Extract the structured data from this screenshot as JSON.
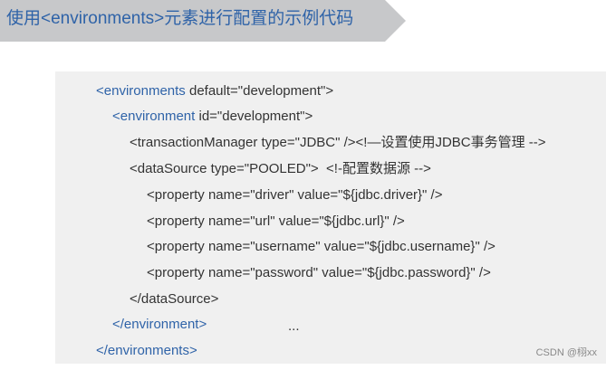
{
  "header": {
    "title": "使用<environments>元素进行配置的示例代码"
  },
  "code": {
    "line1_tag": "<environments",
    "line1_rest": " default=\"development\">",
    "line2_tag": "<environment",
    "line2_rest": " id=\"development\">",
    "line3": "<transactionManager type=\"JDBC\" /><!—设置使用JDBC事务管理 -->",
    "line4": "<dataSource type=\"POOLED\">  <!-配置数据源 -->",
    "line5": "<property name=\"driver\" value=\"${jdbc.driver}\" />",
    "line6": "<property name=\"url\" value=\"${jdbc.url}\" />",
    "line7": "<property name=\"username\" value=\"${jdbc.username}\" />",
    "line8": "<property name=\"password\" value=\"${jdbc.password}\" />",
    "line9": "</dataSource>",
    "line10": "</environment>",
    "line11": "</environments>",
    "ellipsis": "..."
  },
  "watermark": "CSDN @栩xx"
}
